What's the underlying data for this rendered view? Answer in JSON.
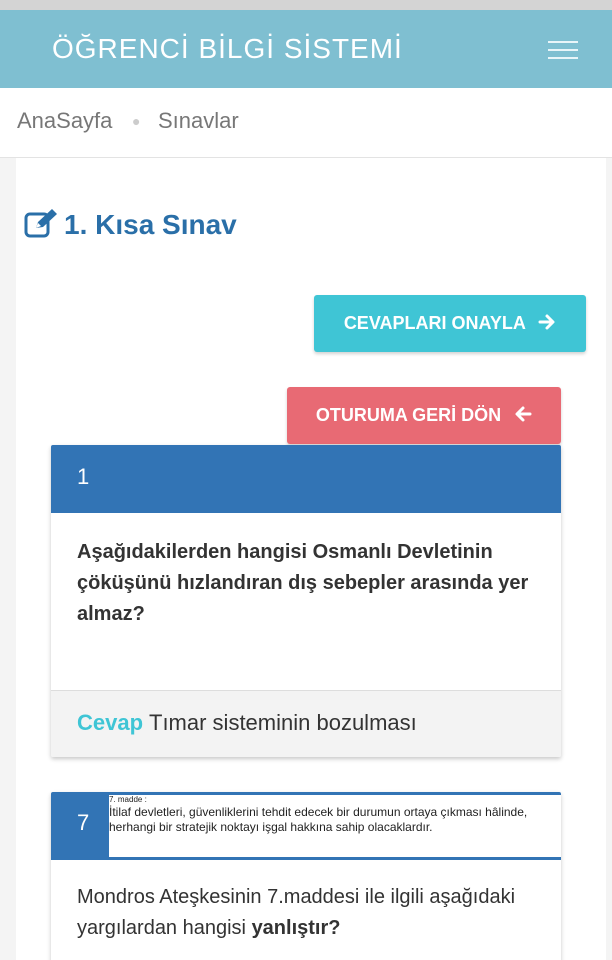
{
  "header": {
    "brand": "ÖĞRENCİ BİLGİ SİSTEMİ",
    "menu_icon": "hamburger-icon",
    "bg_color": "#7fbfd1"
  },
  "breadcrumb": {
    "home": "AnaSayfa",
    "current": "Sınavlar"
  },
  "page": {
    "title": "1. Kısa Sınav",
    "title_icon": "edit-icon",
    "title_color": "#2a6fa8"
  },
  "actions": {
    "confirm_label": "CEVAPLARI ONAYLA",
    "confirm_icon": "arrow-right-icon",
    "confirm_color": "#3fc5d5",
    "back_label": "OTURUMA GERİ DÖN",
    "back_icon": "arrow-left-icon",
    "back_color": "#e86a74"
  },
  "questions": [
    {
      "number": "1",
      "text": "Aşağıdakilerden hangisi Osmanlı Devletinin çöküşünü hızlandıran dış sebepler arasında yer almaz?",
      "answer_label": "Cevap",
      "answer": "Tımar sisteminin bozulması"
    },
    {
      "number": "7",
      "note_title": "7. madde :",
      "note_text": "İtilaf devletleri, güvenliklerini tehdit edecek bir durumun ortaya çıkması hâlinde, herhangi bir stratejik noktayı işgal hakkına sahip olacaklardır.",
      "text_before": "Mondros Ateşkesinin 7.maddesi ile ilgili aşağıdaki yargılardan hangisi ",
      "text_bold": "yanlıştır?"
    }
  ],
  "header_color": "#3274b5"
}
